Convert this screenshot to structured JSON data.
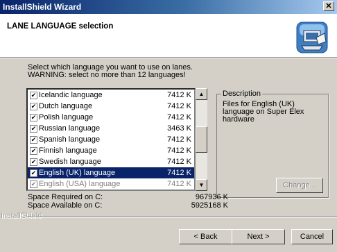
{
  "window": {
    "title": "InstallShield Wizard",
    "close_label": "✕"
  },
  "header": {
    "title": "LANE LANGUAGE selection"
  },
  "instructions": {
    "line1": "Select which language you want to use on lanes.",
    "line2": "WARNING: select no more than 12 languages!"
  },
  "languages": [
    {
      "name": "Icelandic language",
      "size": "7412 K",
      "checked": true
    },
    {
      "name": "Dutch language",
      "size": "7412 K",
      "checked": true
    },
    {
      "name": "Polish language",
      "size": "7412 K",
      "checked": true
    },
    {
      "name": "Russian language",
      "size": "3463 K",
      "checked": true
    },
    {
      "name": "Spanish language",
      "size": "7412 K",
      "checked": true
    },
    {
      "name": "Finnish language",
      "size": "7412 K",
      "checked": true
    },
    {
      "name": "Swedish language",
      "size": "7412 K",
      "checked": true
    },
    {
      "name": "English (UK) language",
      "size": "7412 K",
      "checked": true,
      "selected": true
    },
    {
      "name": "English (USA) language",
      "size": "7412 K",
      "checked": true,
      "disabled": true
    }
  ],
  "scroll": {
    "up": "▲",
    "down": "▼"
  },
  "description": {
    "legend": "Description",
    "text": "Files for English (UK) language on Super Elex hardware",
    "change_label": "Change..."
  },
  "space": {
    "required_label": "Space Required on  C:",
    "required_value": "967936 K",
    "available_label": "Space Available on  C:",
    "available_value": "5925168 K"
  },
  "brand": "InstallShield",
  "buttons": {
    "back": "< Back",
    "next": "Next >",
    "cancel": "Cancel"
  },
  "check_mark": "✔"
}
